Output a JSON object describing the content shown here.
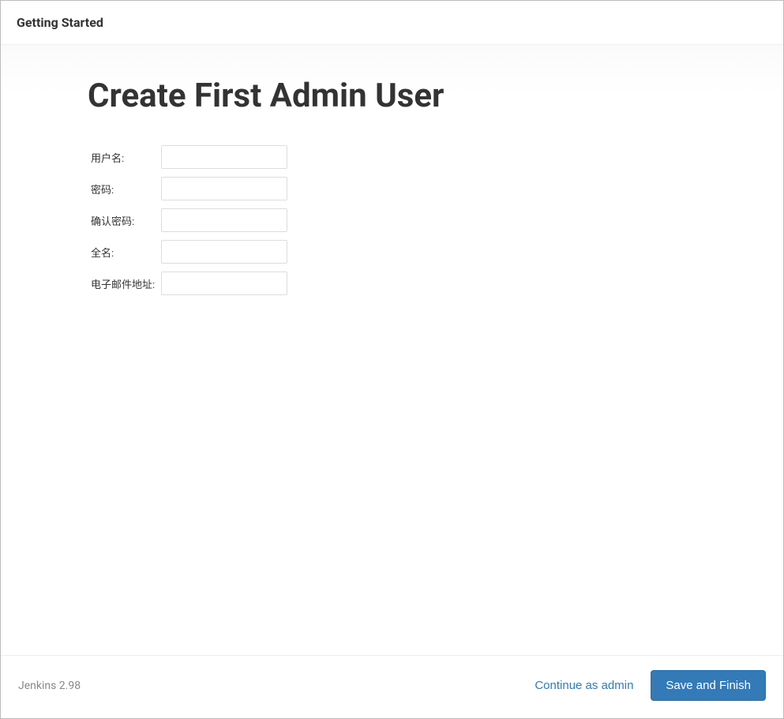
{
  "header": {
    "title": "Getting Started"
  },
  "main": {
    "title": "Create First Admin User"
  },
  "form": {
    "fields": [
      {
        "label": "用户名:",
        "type": "text",
        "name": "username",
        "value": ""
      },
      {
        "label": "密码:",
        "type": "password",
        "name": "password",
        "value": ""
      },
      {
        "label": "确认密码:",
        "type": "password",
        "name": "confirm-password",
        "value": ""
      },
      {
        "label": "全名:",
        "type": "text",
        "name": "fullname",
        "value": ""
      },
      {
        "label": "电子邮件地址:",
        "type": "text",
        "name": "email",
        "value": ""
      }
    ]
  },
  "footer": {
    "version": "Jenkins 2.98",
    "continue_as_admin": "Continue as admin",
    "save_and_finish": "Save and Finish"
  }
}
